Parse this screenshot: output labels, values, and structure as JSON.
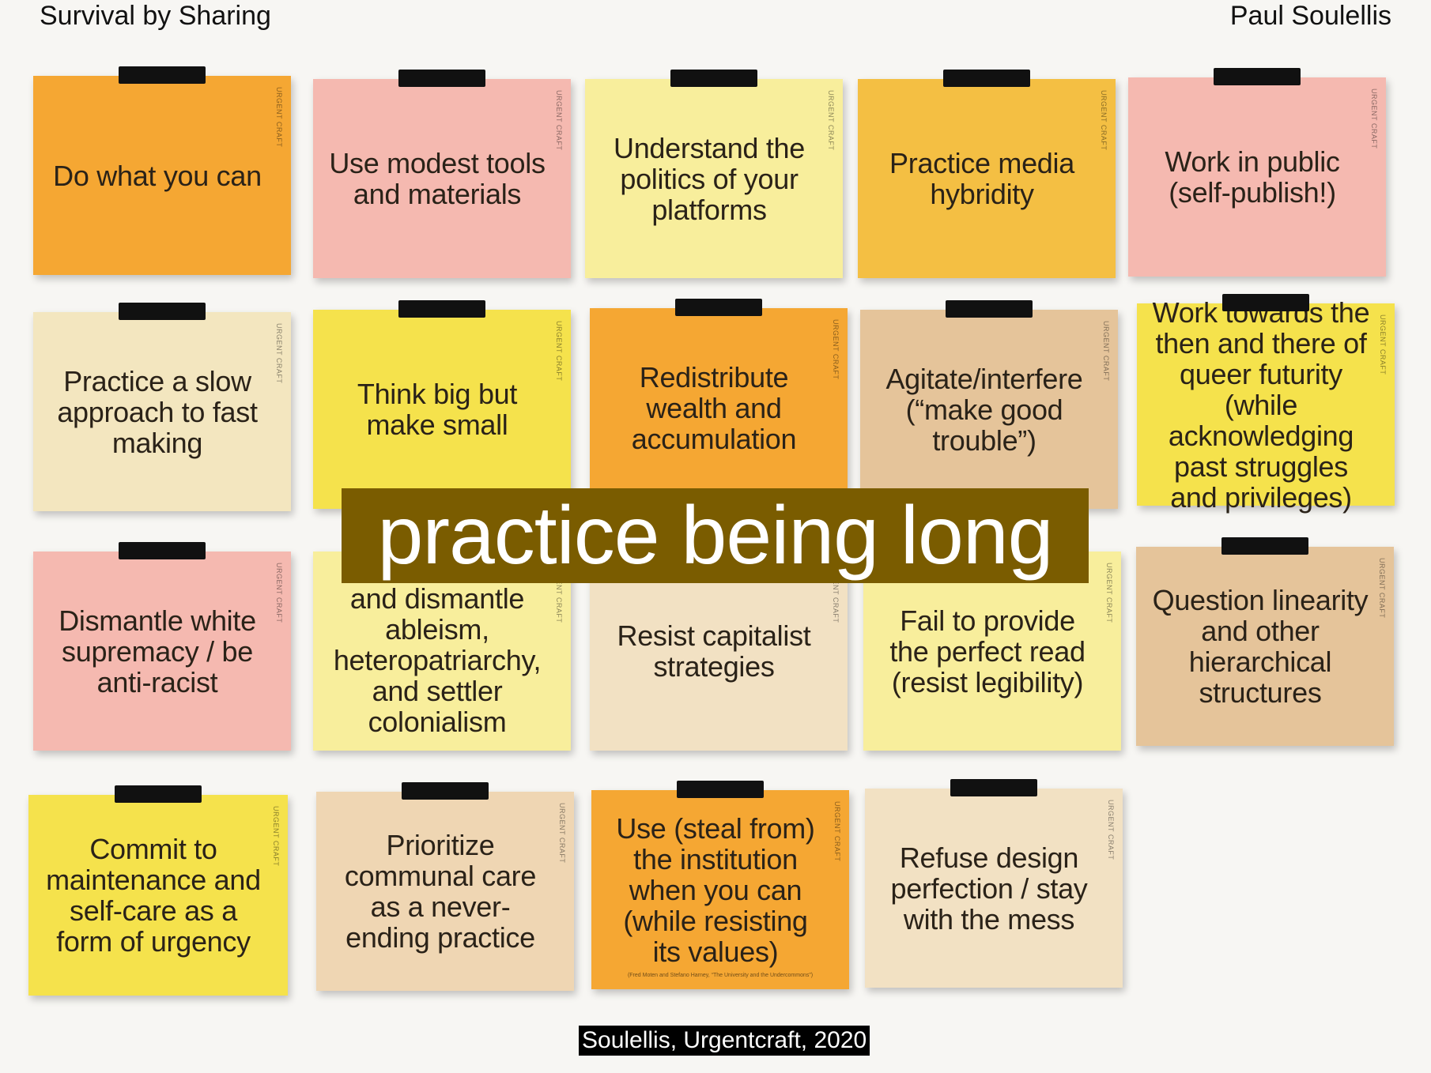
{
  "header": {
    "left": "Survival by Sharing",
    "right": "Paul Soulellis"
  },
  "overlay_text": "practice being long",
  "credit": "Soulellis, Urgentcraft, 2020",
  "tag_text": "URGENT CRAFT",
  "notes": [
    {
      "text": "Do what you can",
      "color": "#f5a733"
    },
    {
      "text": "Use modest tools and materials",
      "color": "#f5b9b0"
    },
    {
      "text": "Understand the politics of your platforms",
      "color": "#f8ee9c"
    },
    {
      "text": "Practice media hybridity",
      "color": "#f4bf43"
    },
    {
      "text": "Work in public (self-publish!)",
      "color": "#f5b9b0"
    },
    {
      "text": "Practice a slow approach to fast making",
      "color": "#f3e6bf"
    },
    {
      "text": "Think big but make small",
      "color": "#f5e24c"
    },
    {
      "text": "Redistribute wealth and accumulation",
      "color": "#f5a733"
    },
    {
      "text": "Agitate/interfere (“make good trouble”)",
      "color": "#e5c49a"
    },
    {
      "text": "Work towards the then and there of queer futurity (while acknowledging past struggles and privileges)",
      "color": "#f5e24c"
    },
    {
      "text": "Dismantle white supremacy / be anti-racist",
      "color": "#f5b9b0"
    },
    {
      "text": "and dismantle ableism, heteropatriarchy, and settler colonialism",
      "color": "#f8ee9c"
    },
    {
      "text": "Resist capitalist strategies",
      "color": "#f2e1c3"
    },
    {
      "text": "Fail to provide the perfect read (resist legibility)",
      "color": "#f8ee9c"
    },
    {
      "text": "Question linearity and other hierarchical structures",
      "color": "#e5c49a"
    },
    {
      "text": "Commit to maintenance and self-care as a form of urgency",
      "color": "#f5e24c"
    },
    {
      "text": "Prioritize communal care as a never-ending practice",
      "color": "#efd6b3"
    },
    {
      "text": "Use (steal from) the institution when you can (while resisting its values)",
      "color": "#f5a733",
      "fine_print": "(Fred Moten and Stefano Harney, “The University and the Undercommons”)"
    },
    {
      "text": "Refuse design perfection / stay with the mess",
      "color": "#f2e1c3"
    }
  ]
}
